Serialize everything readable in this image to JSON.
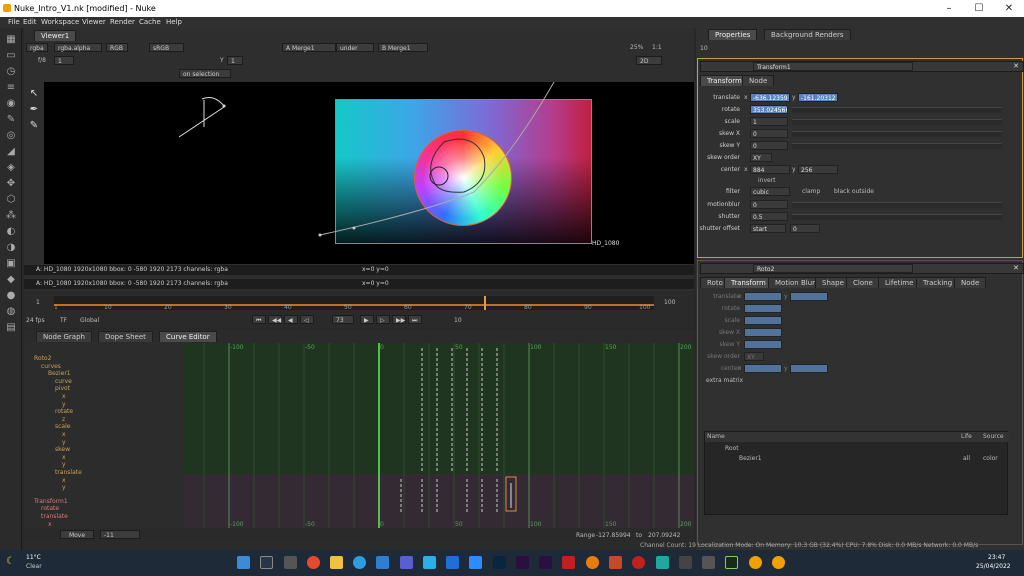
{
  "window": {
    "title": "Nuke_Intro_V1.nk [modified] - Nuke"
  },
  "menu": [
    "File",
    "Edit",
    "Workspace",
    "Viewer",
    "Render",
    "Cache",
    "Help"
  ],
  "viewer": {
    "tab": "Viewer1",
    "channels": "rgba",
    "layer": "rgba.alpha",
    "colorspace_mode": "RGB",
    "lut": "sRGB",
    "input_a": "A  Merge1",
    "blend": "under",
    "input_b": "B  Merge1",
    "zoom": "25%",
    "ratio": "1:1",
    "view_mode": "2D",
    "frame_label": "f/8",
    "frame_value": "1",
    "y_label": "Y",
    "y_value": "1",
    "selection_mode": "on selection",
    "format_label": "HD_1080",
    "info_a": "A:  HD_1080 1920x1080  bbox: 0 -580 1920 2173  channels: rgba",
    "info_a_xy": "x=0 y=0",
    "info_b": "A:  HD_1080 1920x1080  bbox: 0 -580 1920 2173  channels: rgba",
    "info_b_xy": "x=0 y=0"
  },
  "timeline": {
    "start": "1",
    "end": "100",
    "current_frame": "73",
    "fps": "24 fps",
    "tf": "TF",
    "global": "Global",
    "step": "10",
    "ticks": [
      "1",
      "10",
      "20",
      "30",
      "40",
      "50",
      "60",
      "70",
      "80",
      "90",
      "100"
    ]
  },
  "curve_editor": {
    "tabs": [
      "Node Graph",
      "Dope Sheet",
      "Curve Editor"
    ],
    "tree": [
      {
        "label": "Roto2",
        "indent": 0,
        "type": "roto"
      },
      {
        "label": "curves",
        "indent": 1,
        "type": "roto"
      },
      {
        "label": "Bezier1",
        "indent": 2,
        "type": "roto"
      },
      {
        "label": "curve",
        "indent": 3,
        "type": "roto"
      },
      {
        "label": "pivot",
        "indent": 3,
        "type": "roto"
      },
      {
        "label": "x",
        "indent": 4,
        "type": "roto"
      },
      {
        "label": "y",
        "indent": 4,
        "type": "roto"
      },
      {
        "label": "rotate",
        "indent": 3,
        "type": "roto"
      },
      {
        "label": "z",
        "indent": 4,
        "type": "roto"
      },
      {
        "label": "scale",
        "indent": 3,
        "type": "roto"
      },
      {
        "label": "x",
        "indent": 4,
        "type": "roto"
      },
      {
        "label": "y",
        "indent": 4,
        "type": "roto"
      },
      {
        "label": "skew",
        "indent": 3,
        "type": "roto"
      },
      {
        "label": "x",
        "indent": 4,
        "type": "roto"
      },
      {
        "label": "y",
        "indent": 4,
        "type": "roto"
      },
      {
        "label": "translate",
        "indent": 3,
        "type": "roto"
      },
      {
        "label": "x",
        "indent": 4,
        "type": "roto"
      },
      {
        "label": "y",
        "indent": 4,
        "type": "roto"
      },
      {
        "label": "Transform1",
        "indent": 0,
        "type": "transform"
      },
      {
        "label": "rotate",
        "indent": 1,
        "type": "transform"
      },
      {
        "label": "translate",
        "indent": 1,
        "type": "transform"
      },
      {
        "label": "x",
        "indent": 2,
        "type": "transform"
      },
      {
        "label": "y",
        "indent": 2,
        "type": "transform"
      }
    ],
    "top_ticks": [
      "-100",
      "-50",
      "0",
      "50",
      "100",
      "150",
      "200"
    ],
    "mode": "Move",
    "mode_value": "-11",
    "range_label": "Range",
    "range_from": "-127.85994",
    "range_to_label": "to",
    "range_to": "207.09242"
  },
  "properties": {
    "tabs": [
      "Properties",
      "Background Renders"
    ],
    "panel_count": "10",
    "transform": {
      "name": "Transform1",
      "tabs": [
        "Transform",
        "Node"
      ],
      "translate_label": "translate",
      "translate_x_label": "x",
      "translate_x": "-636.12359",
      "translate_y_label": "y",
      "translate_y": "-161.20312",
      "rotate_label": "rotate",
      "rotate": "353.024566",
      "scale_label": "scale",
      "scale": "1",
      "skew_x_label": "skew X",
      "skew_x": "0",
      "skew_y_label": "skew Y",
      "skew_y": "0",
      "skew_order_label": "skew order",
      "skew_order": "XY",
      "center_label": "center",
      "center_x_label": "x",
      "center_x": "884",
      "center_y_label": "y",
      "center_y": "256",
      "invert_label": "invert",
      "filter_label": "filter",
      "filter": "cubic",
      "clamp_label": "clamp",
      "black_outside_label": "black outside",
      "motionblur_label": "motionblur",
      "motionblur": "0",
      "shutter_label": "shutter",
      "shutter": "0.5",
      "shutter_offset_label": "shutter offset",
      "shutter_offset": "start",
      "shutter_offset_value": "0"
    },
    "roto": {
      "name": "Roto2",
      "tabs": [
        "Roto",
        "Transform",
        "Motion Blur",
        "Shape",
        "Clone",
        "Lifetime",
        "Tracking",
        "Node"
      ],
      "labels": [
        "translate",
        "rotate",
        "scale",
        "skew X",
        "skew Y",
        "skew order",
        "center"
      ],
      "translate_x_label": "x",
      "translate_y_label": "y",
      "skew_order": "XY",
      "center_x_label": "x",
      "center_y_label": "y",
      "extra_matrix": "extra matrix",
      "columns": [
        "Name",
        "Life",
        "Source"
      ],
      "rows": [
        {
          "name": "Root",
          "life": "",
          "source": ""
        },
        {
          "name": "Bezier1",
          "life": "all",
          "source": "color"
        }
      ]
    }
  },
  "status": {
    "channel_count": "Channel Count: 19  Localization Mode: On  Memory: 10.3 GB (32.4%)  CPU: 7.8%  Disk: 0.0 MB/s  Network: 0.0 MB/s"
  },
  "taskbar": {
    "weather_temp": "11°C",
    "weather_desc": "Clear",
    "time": "23:47",
    "date": "25/04/2022"
  }
}
